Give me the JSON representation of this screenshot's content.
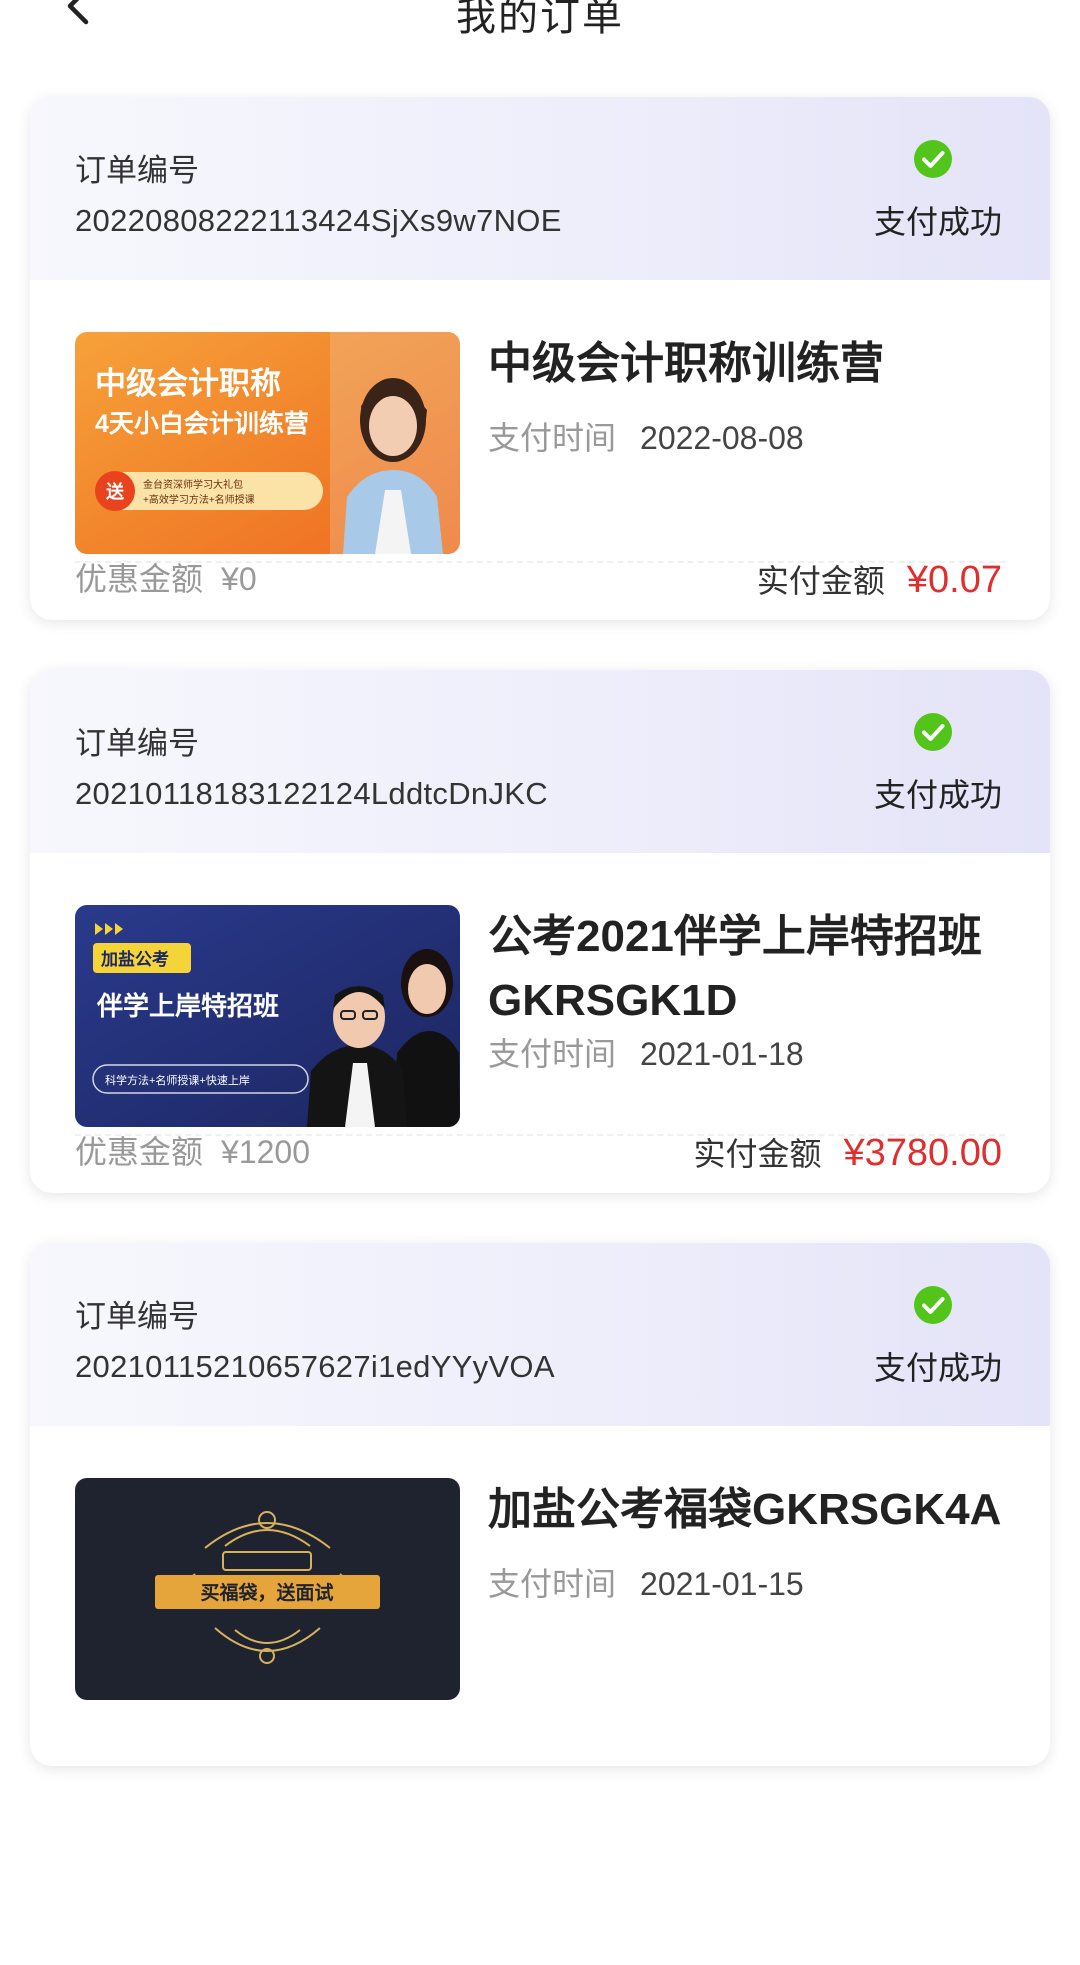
{
  "header": {
    "title": "我的订单",
    "back_icon": "chevron-left-icon"
  },
  "labels": {
    "order_no": "订单编号",
    "pay_time": "支付时间",
    "discount": "优惠金额",
    "paid_amount": "实付金额"
  },
  "colors": {
    "success_green": "#52c41a",
    "price_red": "#e02e2e",
    "header_gradient_end": "#e4e3f8"
  },
  "orders": [
    {
      "order_no": "20220808222113424SjXs9w7NOE",
      "status": "支付成功",
      "status_icon": "check-circle-icon",
      "course_name": "中级会计职称训练营",
      "pay_time": "2022-08-08",
      "discount": "¥0",
      "paid": "¥0.07",
      "thumb": {
        "line1": "中级会计职称",
        "line2": "4天小白会计训练营",
        "badge": "送",
        "note1": "金台资深师学习大礼包",
        "note2": "+高效学习方法+名师授课"
      }
    },
    {
      "order_no": "20210118183122124LddtcDnJKC",
      "status": "支付成功",
      "status_icon": "check-circle-icon",
      "course_name": "公考2021伴学上岸特招班GKRSGK1D",
      "pay_time": "2021-01-18",
      "discount": "¥1200",
      "paid": "¥3780.00",
      "thumb": {
        "tag": "加盐公考",
        "title": "伴学上岸特招班",
        "note": "科学方法+名师授课+快速上岸"
      }
    },
    {
      "order_no": "20210115210657627i1edYYyVOA",
      "status": "支付成功",
      "status_icon": "check-circle-icon",
      "course_name": "加盐公考福袋GKRSGK4A",
      "pay_time": "2021-01-15",
      "thumb": {
        "banner": "买福袋，送面试"
      }
    }
  ]
}
